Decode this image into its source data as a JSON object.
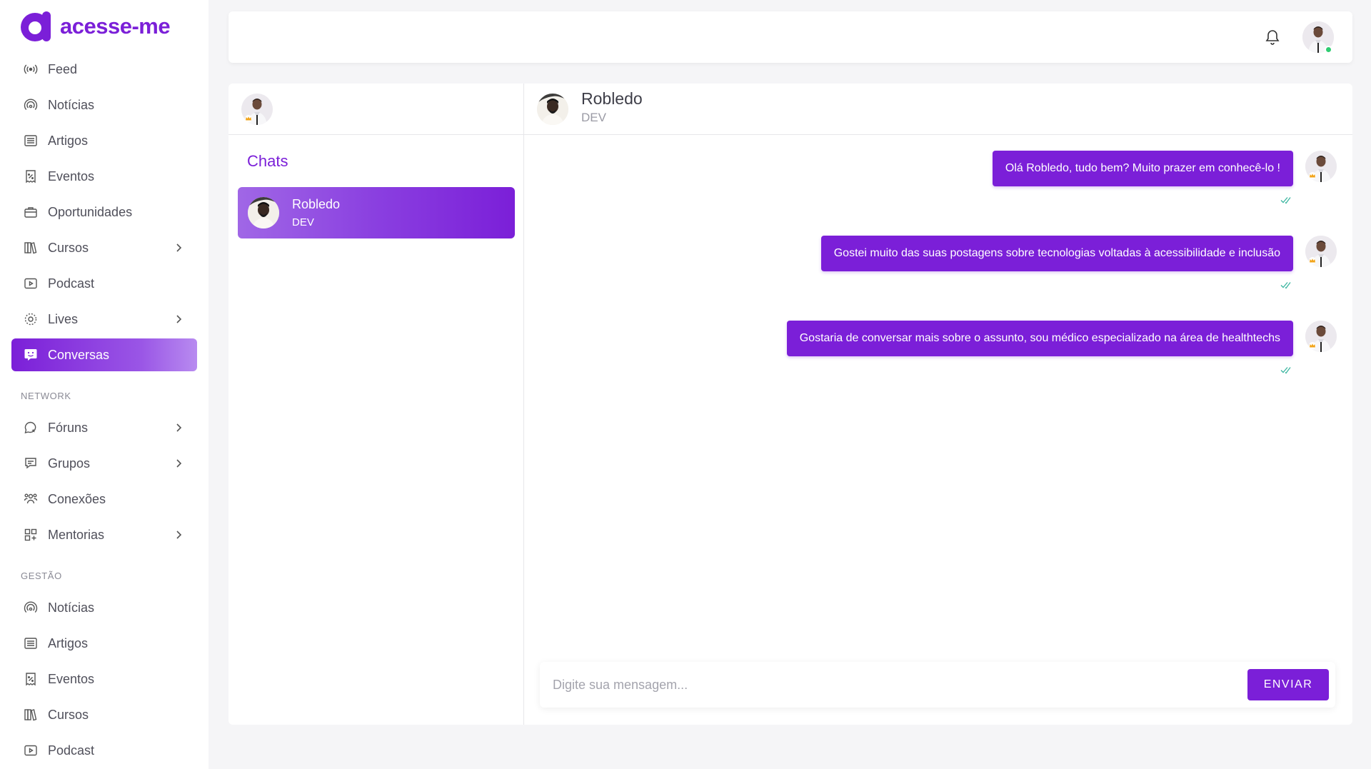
{
  "brand": {
    "name": "acesse-me",
    "color": "#7b1fd8"
  },
  "sidebar": {
    "items": [
      {
        "label": "Feed",
        "icon": "broadcast-icon"
      },
      {
        "label": "Notícias",
        "icon": "signal-icon"
      },
      {
        "label": "Artigos",
        "icon": "article-icon"
      },
      {
        "label": "Eventos",
        "icon": "receipt-icon"
      },
      {
        "label": "Oportunidades",
        "icon": "briefcase-icon"
      },
      {
        "label": "Cursos",
        "icon": "books-icon",
        "expandable": true
      },
      {
        "label": "Podcast",
        "icon": "play-icon"
      },
      {
        "label": "Lives",
        "icon": "live-icon",
        "expandable": true
      },
      {
        "label": "Conversas",
        "icon": "chat-icon",
        "active": true
      }
    ],
    "network_label": "NETWORK",
    "network_items": [
      {
        "label": "Fóruns",
        "icon": "forum-icon",
        "expandable": true
      },
      {
        "label": "Grupos",
        "icon": "group-chat-icon",
        "expandable": true
      },
      {
        "label": "Conexões",
        "icon": "people-icon"
      },
      {
        "label": "Mentorias",
        "icon": "grid-icon",
        "expandable": true
      }
    ],
    "gestao_label": "GESTÃO",
    "gestao_items": [
      {
        "label": "Notícias",
        "icon": "signal-icon"
      },
      {
        "label": "Artigos",
        "icon": "article-icon"
      },
      {
        "label": "Eventos",
        "icon": "receipt-icon"
      },
      {
        "label": "Cursos",
        "icon": "books-icon"
      },
      {
        "label": "Podcast",
        "icon": "play-icon"
      }
    ]
  },
  "chats": {
    "title": "Chats",
    "list": [
      {
        "name": "Robledo",
        "role": "DEV",
        "active": true
      }
    ]
  },
  "conversation": {
    "contact_name": "Robledo",
    "contact_role": "DEV",
    "messages": [
      {
        "text": "Olá Robledo, tudo bem? Muito prazer em conhecê-lo !"
      },
      {
        "text": "Gostei muito das suas postagens sobre tecnologias voltadas à acessibilidade e inclusão"
      },
      {
        "text": "Gostaria de conversar mais sobre o assunto, sou médico especializado na área de healthtechs"
      }
    ],
    "input_placeholder": "Digite sua mensagem...",
    "send_label": "ENVIAR"
  },
  "colors": {
    "accent": "#7b1fd8",
    "online": "#2ecc71",
    "read_check": "#3cb6a0"
  }
}
